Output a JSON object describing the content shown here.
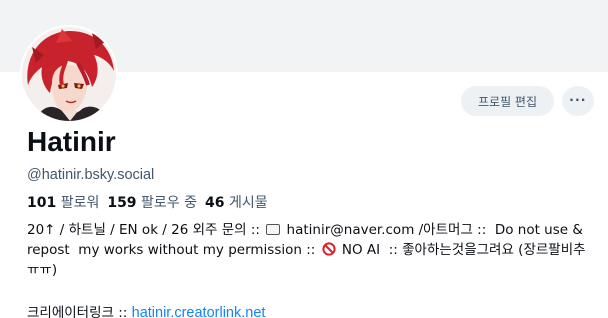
{
  "profile": {
    "display_name": "Hatinir",
    "handle": "@hatinir.bsky.social",
    "edit_label": "프로필 편집",
    "more_label": "···"
  },
  "stats": {
    "followers_count": "101",
    "followers_label": "팔로워",
    "following_count": "159",
    "following_label": "팔로우 중",
    "posts_count": "46",
    "posts_label": "게시물"
  },
  "bio": {
    "part1": "20↑ / 하트닐 / EN ok / 26 외주 문의 :: ",
    "part2": " hatinir@naver.com /아트머그 ::  Do not use & repost  my works without my permission :: ",
    "part3": " NO AI  :: 좋아하는것을그려요 (장르팔비추 ㅠㅠ)",
    "link_prefix": "크리에이터링크 :: ",
    "link_text": "hatinir.creatorlink.net"
  },
  "icons": {
    "avatar": "avatar-illustration",
    "mail": "envelope-icon",
    "prohibited": "no-entry-icon",
    "more": "ellipsis-icon"
  },
  "colors": {
    "banner": "#f1f3f5",
    "muted_text": "#42576c",
    "link": "#1083fe",
    "button_bg": "#eef1f4"
  }
}
